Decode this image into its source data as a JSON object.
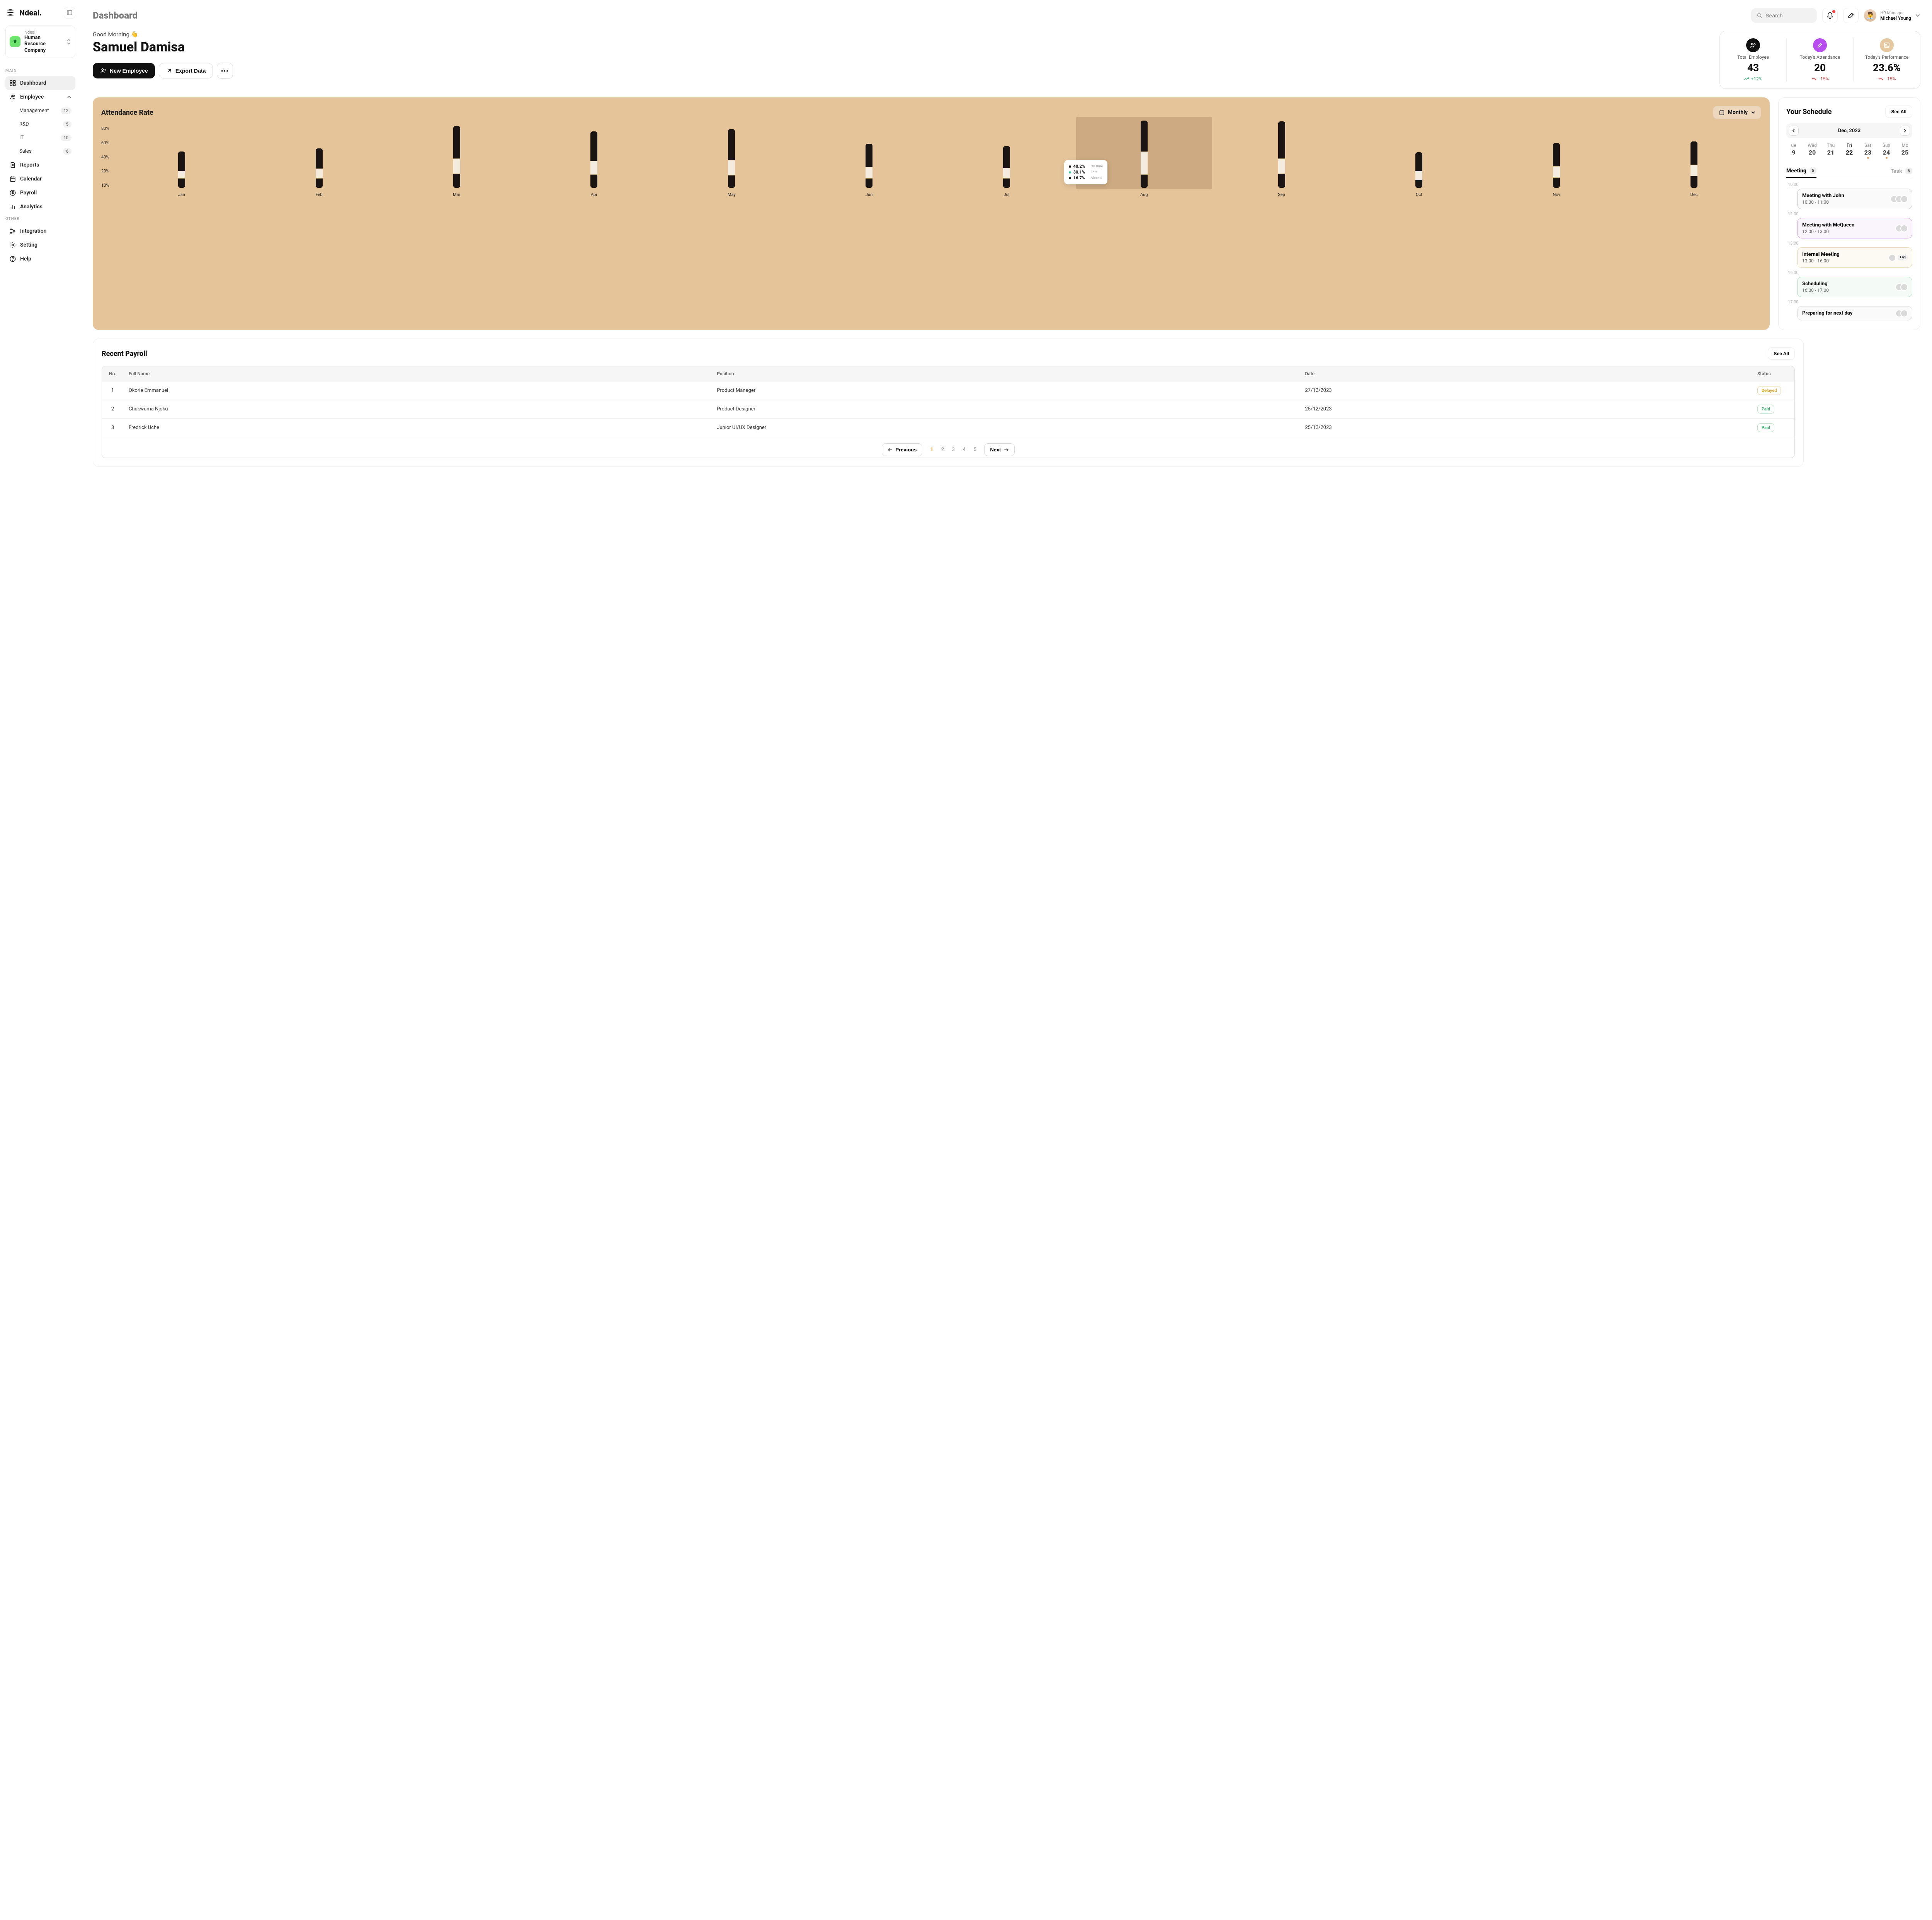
{
  "brand": "Ndeal.",
  "company": {
    "label": "Ndeal",
    "name": "Human Resource Company"
  },
  "sections": {
    "main": "MAIN",
    "other": "OTHER"
  },
  "nav": {
    "dashboard": "Dashboard",
    "employee": "Employee",
    "sub": [
      {
        "label": "Management",
        "count": "12"
      },
      {
        "label": "R&D",
        "count": "5"
      },
      {
        "label": "IT",
        "count": "10"
      },
      {
        "label": "Sales",
        "count": "6"
      }
    ],
    "reports": "Reports",
    "calendar": "Calendar",
    "payroll": "Payroll",
    "analytics": "Analytics",
    "integration": "Integration",
    "setting": "Setting",
    "help": "Help"
  },
  "header": {
    "page_title": "Dashboard",
    "search_placeholder": "Search",
    "user_role": "HR Manager",
    "user_name": "Michael Young",
    "user_emoji": "👨‍💼"
  },
  "greeting": {
    "text": "Good Morning 👋",
    "name": "Samuel Damisa",
    "new_emp": "New Employee",
    "export": "Export Data"
  },
  "stats": [
    {
      "label": "Total Employee",
      "value": "43",
      "delta": "+12%",
      "dir": "up"
    },
    {
      "label": "Today's Attendance",
      "value": "20",
      "delta": "- 15%",
      "dir": "down"
    },
    {
      "label": "Today's Performance",
      "value": "23.6%",
      "delta": "- 15%",
      "dir": "down"
    }
  ],
  "chart_data": {
    "type": "bar",
    "title": "Attendance Rate",
    "period": "Monthly",
    "ylabel": "",
    "ylim": [
      0,
      80
    ],
    "y_ticks": [
      "80%",
      "60%",
      "40%",
      "20%",
      "10%"
    ],
    "categories": [
      "Jan",
      "Feb",
      "Mar",
      "Apr",
      "May",
      "Jun",
      "Jul",
      "Aug",
      "Sep",
      "Oct",
      "Nov",
      "Dec"
    ],
    "series": [
      {
        "name": "On time",
        "values": [
          25,
          26,
          42,
          38,
          40,
          30,
          28,
          40,
          48,
          24,
          30,
          30
        ]
      },
      {
        "name": "Late",
        "values": [
          10,
          13,
          20,
          18,
          20,
          15,
          14,
          30,
          20,
          12,
          15,
          15
        ]
      },
      {
        "name": "Absent",
        "values": [
          12,
          12,
          18,
          17,
          16,
          12,
          12,
          17,
          18,
          10,
          13,
          15
        ]
      }
    ],
    "highlight_index": 7,
    "tooltip": [
      {
        "value": "40.2%",
        "label": "On time"
      },
      {
        "value": "30.1%",
        "label": "Late"
      },
      {
        "value": "16.7%",
        "label": "Absent"
      }
    ]
  },
  "schedule": {
    "title": "Your Schedule",
    "see_all": "See All",
    "month": "Dec, 2023",
    "days": [
      {
        "dow": "ue",
        "num": "9",
        "sel": false,
        "has": false
      },
      {
        "dow": "Wed",
        "num": "20",
        "sel": false,
        "has": false
      },
      {
        "dow": "Thu",
        "num": "21",
        "sel": false,
        "has": false
      },
      {
        "dow": "Fri",
        "num": "22",
        "sel": true,
        "has": false
      },
      {
        "dow": "Sat",
        "num": "23",
        "sel": false,
        "has": true
      },
      {
        "dow": "Sun",
        "num": "24",
        "sel": false,
        "has": true
      },
      {
        "dow": "Mo",
        "num": "25",
        "sel": false,
        "has": false
      }
    ],
    "tabs": {
      "meeting": "Meeting",
      "meeting_count": "5",
      "task": "Task",
      "task_count": "6"
    },
    "events": [
      {
        "slot": "10:00",
        "title": "Meeting with John",
        "time": "10:00 - 11:00",
        "class": "ev1",
        "avs": 3
      },
      {
        "slot": "12:00",
        "title": "Meeting with McQueen",
        "time": "12:00 - 13:00",
        "class": "ev2",
        "avs": 2
      },
      {
        "slot": "13:00",
        "title": "Internal Meeting",
        "time": "13:00 - 16:00",
        "class": "ev3",
        "avs": 1,
        "more": "+41"
      },
      {
        "slot": "16:00",
        "title": "Scheduling",
        "time": "16:00 - 17:00",
        "class": "ev4",
        "avs": 2
      },
      {
        "slot": "17:00",
        "title": "Preparing for next day",
        "time": "",
        "class": "ev5",
        "avs": 2
      }
    ]
  },
  "payroll": {
    "title": "Recent Payroll",
    "see_all": "See All",
    "columns": {
      "no": "No.",
      "name": "Full Name",
      "pos": "Position",
      "date": "Date",
      "status": "Status"
    },
    "rows": [
      {
        "no": "1",
        "name": "Okorie Emmanuel",
        "pos": "Product Manager",
        "date": "27/12/2023",
        "status": "Delayed",
        "status_class": "delayed"
      },
      {
        "no": "2",
        "name": "Chukwuma Njoku",
        "pos": "Product Designer",
        "date": "25/12/2023",
        "status": "Paid",
        "status_class": "paid"
      },
      {
        "no": "3",
        "name": "Fredrick Uche",
        "pos": "Junior UI/UX Designer",
        "date": "25/12/2023",
        "status": "Paid",
        "status_class": "paid"
      }
    ],
    "pager": {
      "prev": "Previous",
      "next": "Next",
      "pages": [
        "1",
        "2",
        "3",
        "4",
        "5"
      ],
      "active": 0
    }
  }
}
